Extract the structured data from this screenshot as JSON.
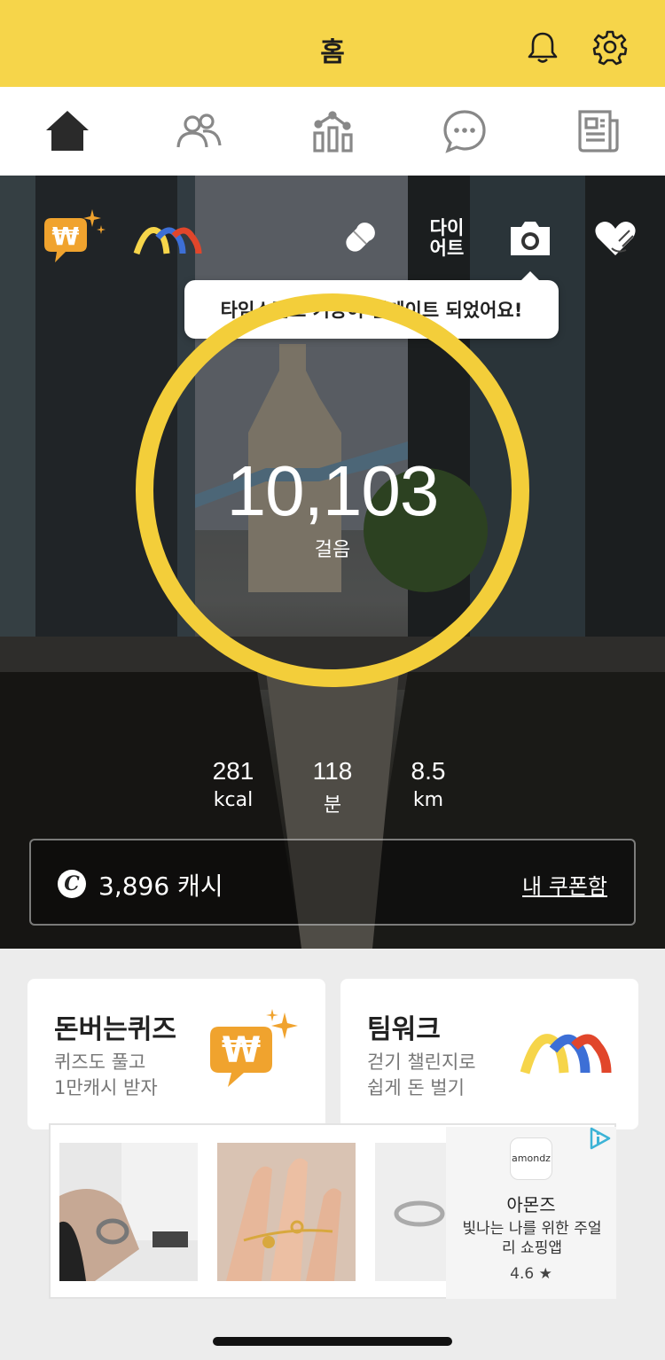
{
  "header": {
    "title": "홈"
  },
  "hero": {
    "diet_label_line1": "다이",
    "diet_label_line2": "어트",
    "tooltip": "타임스탬프 기능이 업데이트 되었어요!",
    "steps": "10,103",
    "steps_unit": "걸음",
    "stats": {
      "kcal_value": "281",
      "kcal_unit": "kcal",
      "minutes_value": "118",
      "minutes_unit": "분",
      "km_value": "8.5",
      "km_unit": "km"
    },
    "cash_coin_letter": "C",
    "cash_value": "3,896 캐시",
    "coupon_link": "내 쿠폰함"
  },
  "cards": [
    {
      "title": "돈버는퀴즈",
      "desc_line1": "퀴즈도 풀고",
      "desc_line2": "1만캐시 받자"
    },
    {
      "title": "팀워크",
      "desc_line1": "걷기 챌린지로",
      "desc_line2": "쉽게 돈 벌기"
    }
  ],
  "ad": {
    "logo_text": "amondz",
    "name": "아몬즈",
    "desc": "빛나는 나를 위한 주얼리 쇼핑앱",
    "rating": "4.6 ★"
  },
  "colors": {
    "brand_yellow": "#f6d54a",
    "ring_yellow": "#f3ce3a",
    "quiz_orange": "#f0a32e"
  }
}
